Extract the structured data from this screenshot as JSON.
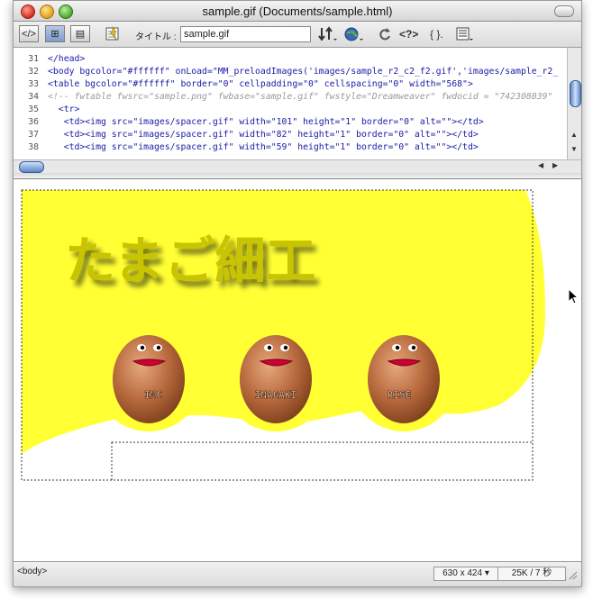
{
  "window": {
    "title": "sample.gif (Documents/sample.html)"
  },
  "toolbar": {
    "title_label": "タイトル :",
    "title_value": "sample.gif",
    "buttons": {
      "code_view": "</>",
      "split_view": "⊞",
      "design_view": "▤",
      "brace": "{ }.",
      "help": "<?>"
    }
  },
  "code_lines": [
    {
      "num": "31",
      "text": "</head>"
    },
    {
      "num": "32",
      "text": "<body bgcolor=\"#ffffff\" onLoad=\"MM_preloadImages('images/sample_r2_c2_f2.gif','images/sample_r2_"
    },
    {
      "num": "33",
      "text": "<table bgcolor=\"#ffffff\" border=\"0\" cellpadding=\"0\" cellspacing=\"0\" width=\"568\">"
    },
    {
      "num": "34",
      "text": "<!-- fwtable fwsrc=\"sample.png\" fwbase=\"sample.gif\" fwstyle=\"Dreamweaver\" fwdocid = \"742308039\""
    },
    {
      "num": "35",
      "text": "  <tr>"
    },
    {
      "num": "36",
      "text": "   <td><img src=\"images/spacer.gif\" width=\"101\" height=\"1\" border=\"0\" alt=\"\"></td>"
    },
    {
      "num": "37",
      "text": "   <td><img src=\"images/spacer.gif\" width=\"82\" height=\"1\" border=\"0\" alt=\"\"></td>"
    },
    {
      "num": "38",
      "text": "   <td><img src=\"images/spacer.gif\" width=\"59\" height=\"1\" border=\"0\" alt=\"\"></td>"
    }
  ],
  "design": {
    "heading": "たまご細工",
    "eggs": [
      "IMC",
      "INAGAKI",
      "RISE"
    ],
    "colors": {
      "yellow": "#ffff33",
      "egg": "#b86a3e",
      "mouth": "#cc0033"
    }
  },
  "status": {
    "tag": "<body>",
    "dimensions": "630 x 424 ▾",
    "size": "25K / 7 秒"
  }
}
